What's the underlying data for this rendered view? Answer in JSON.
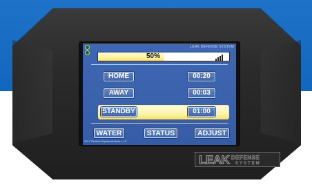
{
  "screen": {
    "brand": "LEAK DEFENSE SYSTEM",
    "progress": {
      "value": 0.5,
      "label": "50%"
    },
    "signal_bars": 4,
    "modes": [
      {
        "label": "HOME",
        "time": "00:20"
      },
      {
        "label": "AWAY",
        "time": "00:03"
      },
      {
        "label": "STANDBY",
        "time": "01:00"
      }
    ],
    "selected_mode": "STANDBY",
    "footer_buttons": {
      "water": "WATER",
      "status": "STATUS",
      "adjust": "ADJUST"
    },
    "copyright": "2017 Sentinel Hydrosolutions, LLC"
  },
  "logo": {
    "main": "LEAK",
    "sub": "DEFENSE",
    "system": "SYSTEM"
  },
  "colors": {
    "background_blue": "#1e73c8",
    "screen_blue": "#3e67b3",
    "highlight_yellow": "#fff39a",
    "device_body": "#2b2b2b"
  }
}
